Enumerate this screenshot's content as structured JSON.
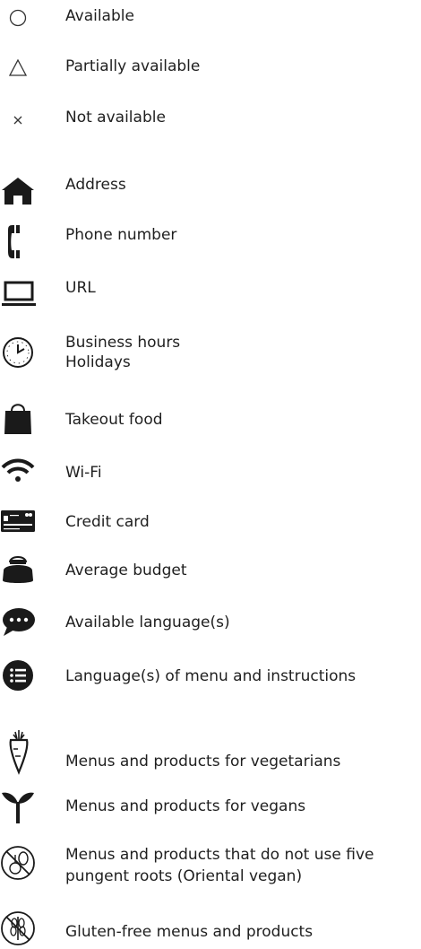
{
  "legend": {
    "available": "Available",
    "partially_available": "Partially available",
    "not_available": "Not available",
    "address": "Address",
    "phone_number": "Phone number",
    "url": "URL",
    "business_hours": "Business hours",
    "holidays": "Holidays",
    "takeout_food": "Takeout food",
    "wifi": "Wi-Fi",
    "credit_card": "Credit card",
    "average_budget": "Average budget",
    "available_languages": "Available language(s)",
    "menu_languages": "Language(s) of menu and instructions",
    "vegetarian": "Menus and products for vegetarians",
    "vegan": "Menus and products for vegans",
    "oriental_vegan_line1": "Menus and products that do not use five",
    "oriental_vegan_line2": "pungent roots (Oriental vegan)",
    "gluten_free": "Gluten-free menus and products"
  },
  "icons": [
    "circle-icon",
    "triangle-icon",
    "cross-icon",
    "home-icon",
    "phone-icon",
    "laptop-icon",
    "clock-icon",
    "bag-icon",
    "wifi-icon",
    "credit-card-icon",
    "purse-icon",
    "speech-bubble-icon",
    "list-icon",
    "carrot-icon",
    "sprout-icon",
    "no-garlic-icon",
    "no-wheat-icon"
  ],
  "colors": {
    "icon": "#1a1a1a",
    "text": "#1f1f1f"
  }
}
